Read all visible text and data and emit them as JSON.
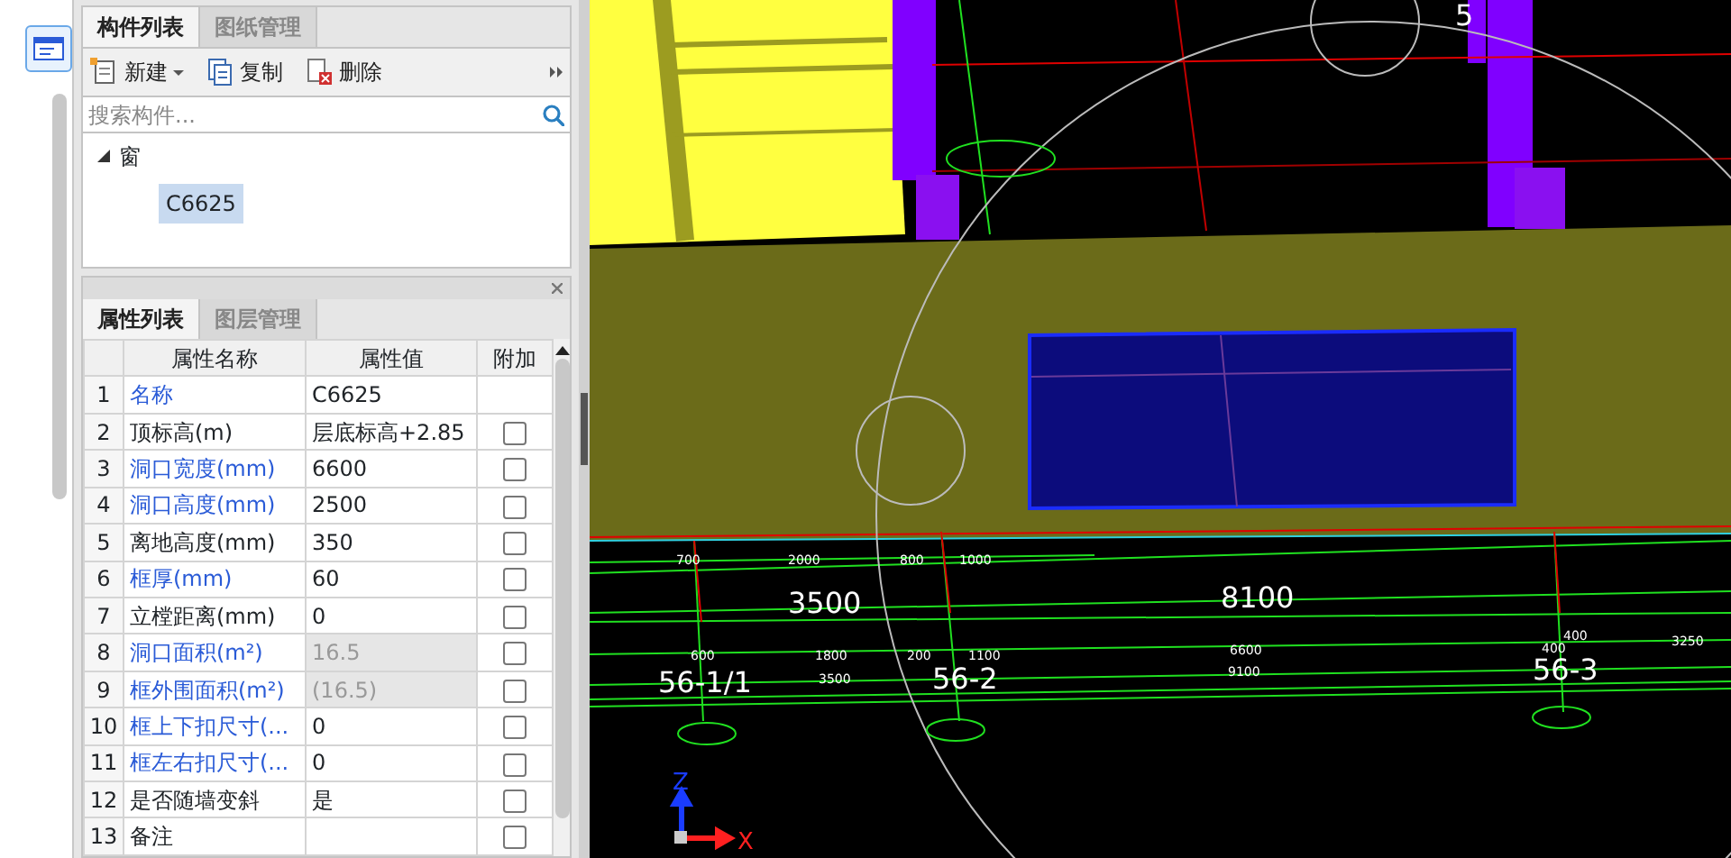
{
  "component_panel": {
    "tabs": [
      {
        "label": "构件列表",
        "selected": true
      },
      {
        "label": "图纸管理",
        "selected": false
      }
    ],
    "toolbar": [
      {
        "label": "新建",
        "kind": "new"
      },
      {
        "label": "复制",
        "kind": "copy"
      },
      {
        "label": "删除",
        "kind": "delete"
      }
    ],
    "search": {
      "placeholder": "搜索构件..."
    },
    "tree": [
      {
        "label": "窗",
        "expanded": true,
        "children": [
          {
            "label": "C6625",
            "selected": true
          }
        ]
      }
    ]
  },
  "property_panel": {
    "tabs": [
      {
        "label": "属性列表",
        "selected": true
      },
      {
        "label": "图层管理",
        "selected": false
      }
    ],
    "columns": [
      "属性名称",
      "属性值",
      "附加"
    ],
    "rows": [
      {
        "index": "1",
        "name": "名称",
        "value": "C6625",
        "public": true,
        "readonly": false
      },
      {
        "index": "2",
        "name": "顶标高(m)",
        "value": "层底标高+2.85",
        "public": false,
        "readonly": false,
        "checked": false
      },
      {
        "index": "3",
        "name": "洞口宽度(mm)",
        "value": "6600",
        "public": true,
        "readonly": false,
        "checked": false
      },
      {
        "index": "4",
        "name": "洞口高度(mm)",
        "value": "2500",
        "public": true,
        "readonly": false,
        "checked": false
      },
      {
        "index": "5",
        "name": "离地高度(mm)",
        "value": "350",
        "public": false,
        "readonly": false,
        "checked": false
      },
      {
        "index": "6",
        "name": "框厚(mm)",
        "value": "60",
        "public": true,
        "readonly": false,
        "checked": false
      },
      {
        "index": "7",
        "name": "立樘距离(mm)",
        "value": "0",
        "public": false,
        "readonly": false,
        "checked": false
      },
      {
        "index": "8",
        "name": "洞口面积(m²)",
        "value": "16.5",
        "public": true,
        "readonly": true,
        "checked": false
      },
      {
        "index": "9",
        "name": "框外围面积(m²)",
        "value": "(16.5)",
        "public": true,
        "readonly": true,
        "checked": false
      },
      {
        "index": "10",
        "name": "框上下扣尺寸(...",
        "value": "0",
        "public": true,
        "readonly": false,
        "checked": false
      },
      {
        "index": "11",
        "name": "框左右扣尺寸(...",
        "value": "0",
        "public": true,
        "readonly": false,
        "checked": false
      },
      {
        "index": "12",
        "name": "是否随墙变斜",
        "value": "是",
        "public": false,
        "readonly": false,
        "checked": false
      },
      {
        "index": "13",
        "name": "备注",
        "value": "",
        "public": false,
        "readonly": false,
        "checked": false
      }
    ]
  },
  "viewport": {
    "labels": [
      {
        "text": "5",
        "kind": "major"
      },
      {
        "text": "700",
        "kind": "minor"
      },
      {
        "text": "2000",
        "kind": "minor"
      },
      {
        "text": "800",
        "kind": "minor"
      },
      {
        "text": "1000",
        "kind": "minor"
      },
      {
        "text": "3500",
        "kind": "major"
      },
      {
        "text": "8100",
        "kind": "major"
      },
      {
        "text": "600",
        "kind": "minor"
      },
      {
        "text": "1800",
        "kind": "minor"
      },
      {
        "text": "200",
        "kind": "minor"
      },
      {
        "text": "1100",
        "kind": "minor"
      },
      {
        "text": "6600",
        "kind": "minor"
      },
      {
        "text": "400",
        "kind": "minor"
      },
      {
        "text": "400",
        "kind": "minor"
      },
      {
        "text": "3250",
        "kind": "minor"
      },
      {
        "text": "56-1/1",
        "kind": "major"
      },
      {
        "text": "3500",
        "kind": "minor"
      },
      {
        "text": "56-2",
        "kind": "major"
      },
      {
        "text": "9100",
        "kind": "minor"
      },
      {
        "text": "56-3",
        "kind": "major"
      }
    ],
    "axes": [
      "Z",
      "X"
    ]
  }
}
